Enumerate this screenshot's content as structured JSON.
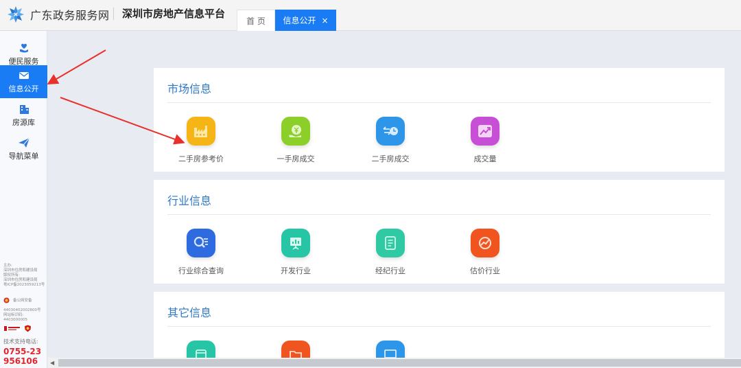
{
  "header": {
    "gov_name": "广东政务服务网",
    "platform_name": "深圳市房地产信息平台",
    "tabs": [
      {
        "label": "首 页",
        "active": false
      },
      {
        "label": "信息公开",
        "active": true,
        "close": "×"
      }
    ]
  },
  "sidebar": {
    "items": [
      {
        "label": "便民服务",
        "icon": "heart-hand-icon"
      },
      {
        "label": "信息公开",
        "icon": "envelope-icon",
        "active": true
      },
      {
        "label": "房源库",
        "icon": "building-icon"
      },
      {
        "label": "导航菜单",
        "icon": "paper-plane-icon"
      }
    ],
    "footer": {
      "sponsor_label": "主办:",
      "sponsor": "深圳市住房和建设局",
      "copyright_label": "版权所有:",
      "copyright": "深圳市住房和建设局",
      "icp": "粤ICP备2023059213号",
      "police_label": "备公网安备",
      "police_no": "44030402002800号",
      "site_id_label": "网站标识码:",
      "site_id": "4403000005",
      "support_label": "技术支持电话:",
      "phone": "0755-23956106"
    }
  },
  "sections": [
    {
      "title": "市场信息",
      "items": [
        {
          "label": "二手房参考价",
          "icon": "factory-icon",
          "color": "#f5b516"
        },
        {
          "label": "一手房成交",
          "icon": "money-bag-icon",
          "color": "#8ccf28"
        },
        {
          "label": "二手房成交",
          "icon": "transfer-clock-icon",
          "color": "#2e96e8"
        },
        {
          "label": "成交量",
          "icon": "trend-chart-icon",
          "color": "#c64fd6"
        }
      ]
    },
    {
      "title": "行业信息",
      "items": [
        {
          "label": "行业综合查询",
          "icon": "search-list-icon",
          "color": "#2f6be0"
        },
        {
          "label": "开发行业",
          "icon": "presentation-icon",
          "color": "#26c5a5"
        },
        {
          "label": "经纪行业",
          "icon": "document-icon",
          "color": "#2fc9a4"
        },
        {
          "label": "估价行业",
          "icon": "gauge-icon",
          "color": "#f0551f"
        }
      ]
    },
    {
      "title": "其它信息",
      "items": [
        {
          "icon": "calendar-icon",
          "color": "#26c5a5"
        },
        {
          "icon": "folder-icon",
          "color": "#f0551f"
        },
        {
          "icon": "monitor-icon",
          "color": "#2e96e8"
        }
      ]
    }
  ],
  "colors": {
    "accent": "#1a7cf5",
    "section_title": "#2e78c8",
    "annotation_arrow": "#e8312b"
  }
}
